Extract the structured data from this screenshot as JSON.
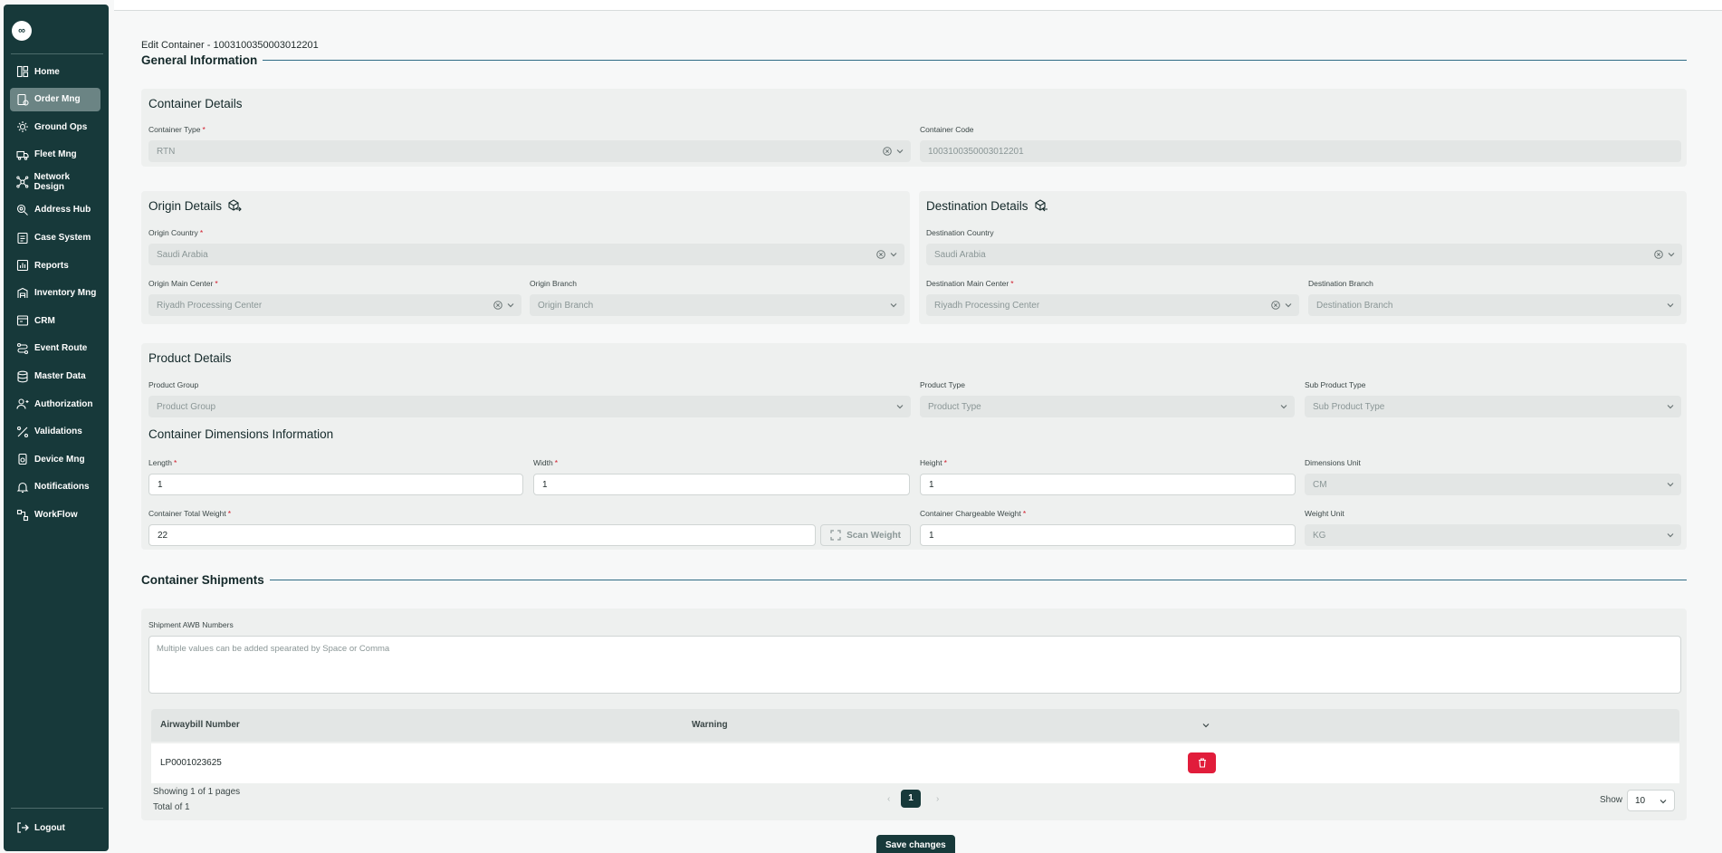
{
  "sidebar": {
    "logo": "∞",
    "items": [
      {
        "label": "Home",
        "icon": "home-icon"
      },
      {
        "label": "Order Mng",
        "icon": "order-icon",
        "active": true
      },
      {
        "label": "Ground Ops",
        "icon": "ground-ops-icon"
      },
      {
        "label": "Fleet Mng",
        "icon": "truck-icon"
      },
      {
        "label": "Network Design",
        "icon": "network-icon"
      },
      {
        "label": "Address Hub",
        "icon": "address-icon"
      },
      {
        "label": "Case System",
        "icon": "case-icon"
      },
      {
        "label": "Reports",
        "icon": "reports-icon"
      },
      {
        "label": "Inventory Mng",
        "icon": "inventory-icon"
      },
      {
        "label": "CRM",
        "icon": "crm-icon"
      },
      {
        "label": "Event Route",
        "icon": "route-icon"
      },
      {
        "label": "Master Data",
        "icon": "database-icon"
      },
      {
        "label": "Authorization",
        "icon": "user-icon"
      },
      {
        "label": "Validations",
        "icon": "validations-icon"
      },
      {
        "label": "Device Mng",
        "icon": "device-icon"
      },
      {
        "label": "Notifications",
        "icon": "bell-icon"
      },
      {
        "label": "WorkFlow",
        "icon": "workflow-icon"
      }
    ],
    "logout": "Logout"
  },
  "page": {
    "title": "Edit Container - 1003100350003012201",
    "general_heading": "General Information",
    "shipments_heading": "Container Shipments",
    "save_label": "Save changes"
  },
  "container_details": {
    "title": "Container Details",
    "type_label": "Container Type",
    "type_value": "RTN",
    "code_label": "Container Code",
    "code_value": "1003100350003012201"
  },
  "origin": {
    "title": "Origin Details",
    "country_label": "Origin Country",
    "country_value": "Saudi Arabia",
    "main_center_label": "Origin Main Center",
    "main_center_value": "Riyadh Processing Center",
    "branch_label": "Origin Branch",
    "branch_placeholder": "Origin Branch"
  },
  "destination": {
    "title": "Destination Details",
    "country_label": "Destination Country",
    "country_value": "Saudi Arabia",
    "main_center_label": "Destination Main Center",
    "main_center_value": "Riyadh Processing Center",
    "branch_label": "Destination Branch",
    "branch_placeholder": "Destination Branch"
  },
  "product": {
    "title": "Product Details",
    "group_label": "Product Group",
    "group_placeholder": "Product Group",
    "type_label": "Product Type",
    "type_placeholder": "Product Type",
    "subtype_label": "Sub Product Type",
    "subtype_placeholder": "Sub Product Type"
  },
  "dimensions": {
    "title": "Container Dimensions Information",
    "length_label": "Length",
    "length_value": "1",
    "width_label": "Width",
    "width_value": "1",
    "height_label": "Height",
    "height_value": "1",
    "unit_label": "Dimensions Unit",
    "unit_value": "CM",
    "total_weight_label": "Container Total Weight",
    "total_weight_value": "22",
    "scan_label": "Scan Weight",
    "chargeable_label": "Container Chargeable Weight",
    "chargeable_value": "1",
    "weight_unit_label": "Weight Unit",
    "weight_unit_value": "KG"
  },
  "shipments": {
    "awb_label": "Shipment AWB Numbers",
    "awb_placeholder": "Multiple values can be added spearated by Space or Comma",
    "columns": [
      "Airwaybill Number",
      "Warning"
    ],
    "rows": [
      {
        "awb": "LP0001023625",
        "warning": ""
      }
    ],
    "showing": "Showing 1 of 1 pages",
    "total": "Total of 1",
    "current_page": "1",
    "show_label": "Show",
    "page_size": "10"
  }
}
